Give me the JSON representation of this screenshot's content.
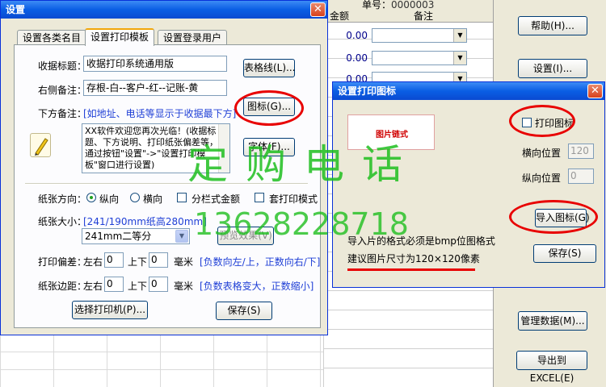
{
  "background": {
    "partial_header": "单号：",
    "partial_header_value": "0000003",
    "col_amount": "金额",
    "col_note": "备注",
    "rows": [
      "0.00",
      "0.00",
      "0.00"
    ],
    "right_buttons": [
      "帮助(H)...",
      "设置(I)...",
      "管理数据(M)...",
      "导出到EXCEL(E)"
    ]
  },
  "settings": {
    "title": "设置",
    "tabs": [
      "设置各类名目",
      "设置打印模板",
      "设置登录用户"
    ],
    "active_tab": 1,
    "receipt_title_label": "收据标题：",
    "receipt_title_value": "收据打印系统通用版",
    "grid_button": "表格线(L)...",
    "right_note_label": "右侧备注：",
    "right_note_value": "存根-白--客户-红--记账-黄",
    "bottom_note_label": "下方备注：",
    "bottom_note_hint": "[如地址、电话等显示于收据最下方]",
    "icon_button": "图标(G)...",
    "font_button": "字体(F)...",
    "bottom_note_text": "XX软件欢迎您再次光临！(收据标题、下方说明、打印纸张偏差等，可通过按钮\"设置\"->\"设置打印模板\"窗口进行设置)",
    "paper_direction_label": "纸张方向：",
    "portrait": "纵向",
    "landscape": "横向",
    "column_amount": "分栏式金额",
    "overlay_print": "套打印模式",
    "paper_size_label": "纸张大小：",
    "paper_size_hint": "[241/190mm纸高280mm]",
    "paper_size_value": "241mm二等分",
    "preview_button": "预览效果(V)",
    "offset_label": "打印偏差：",
    "left_right": "左右",
    "up_down": "上下",
    "offset_lr_value": "0",
    "offset_ud_value": "0",
    "mm": "毫米",
    "offset_hint": "[负数向左/上，正数向右/下]",
    "margin_label": "纸张边距：",
    "margin_lr_value": "0",
    "margin_ud_value": "0",
    "margin_hint": "[负数表格变大，正数缩小]",
    "choose_printer_button": "选择打印机(P)...",
    "save_button": "保存(S)"
  },
  "icon_dialog": {
    "title": "设置打印图标",
    "preview_text": "图片链式",
    "print_icon_label": "打印图标",
    "h_pos_label": "横向位置",
    "h_pos_value": "120",
    "v_pos_label": "纵向位置",
    "v_pos_value": "0",
    "import_button": "导入图标(G)",
    "format_note": "导入片的格式必须是bmp位图格式",
    "size_note": "建议图片尺寸为120×120像素",
    "save_button": "保存(S)"
  },
  "watermark": {
    "line1": "定购电话",
    "line2": "13628228718"
  },
  "colors": {
    "title_blue": "#0a5ee4",
    "hint_blue": "#1f3fd6",
    "annotation_red": "#e80000",
    "watermark_green": "#1fbf1f"
  }
}
